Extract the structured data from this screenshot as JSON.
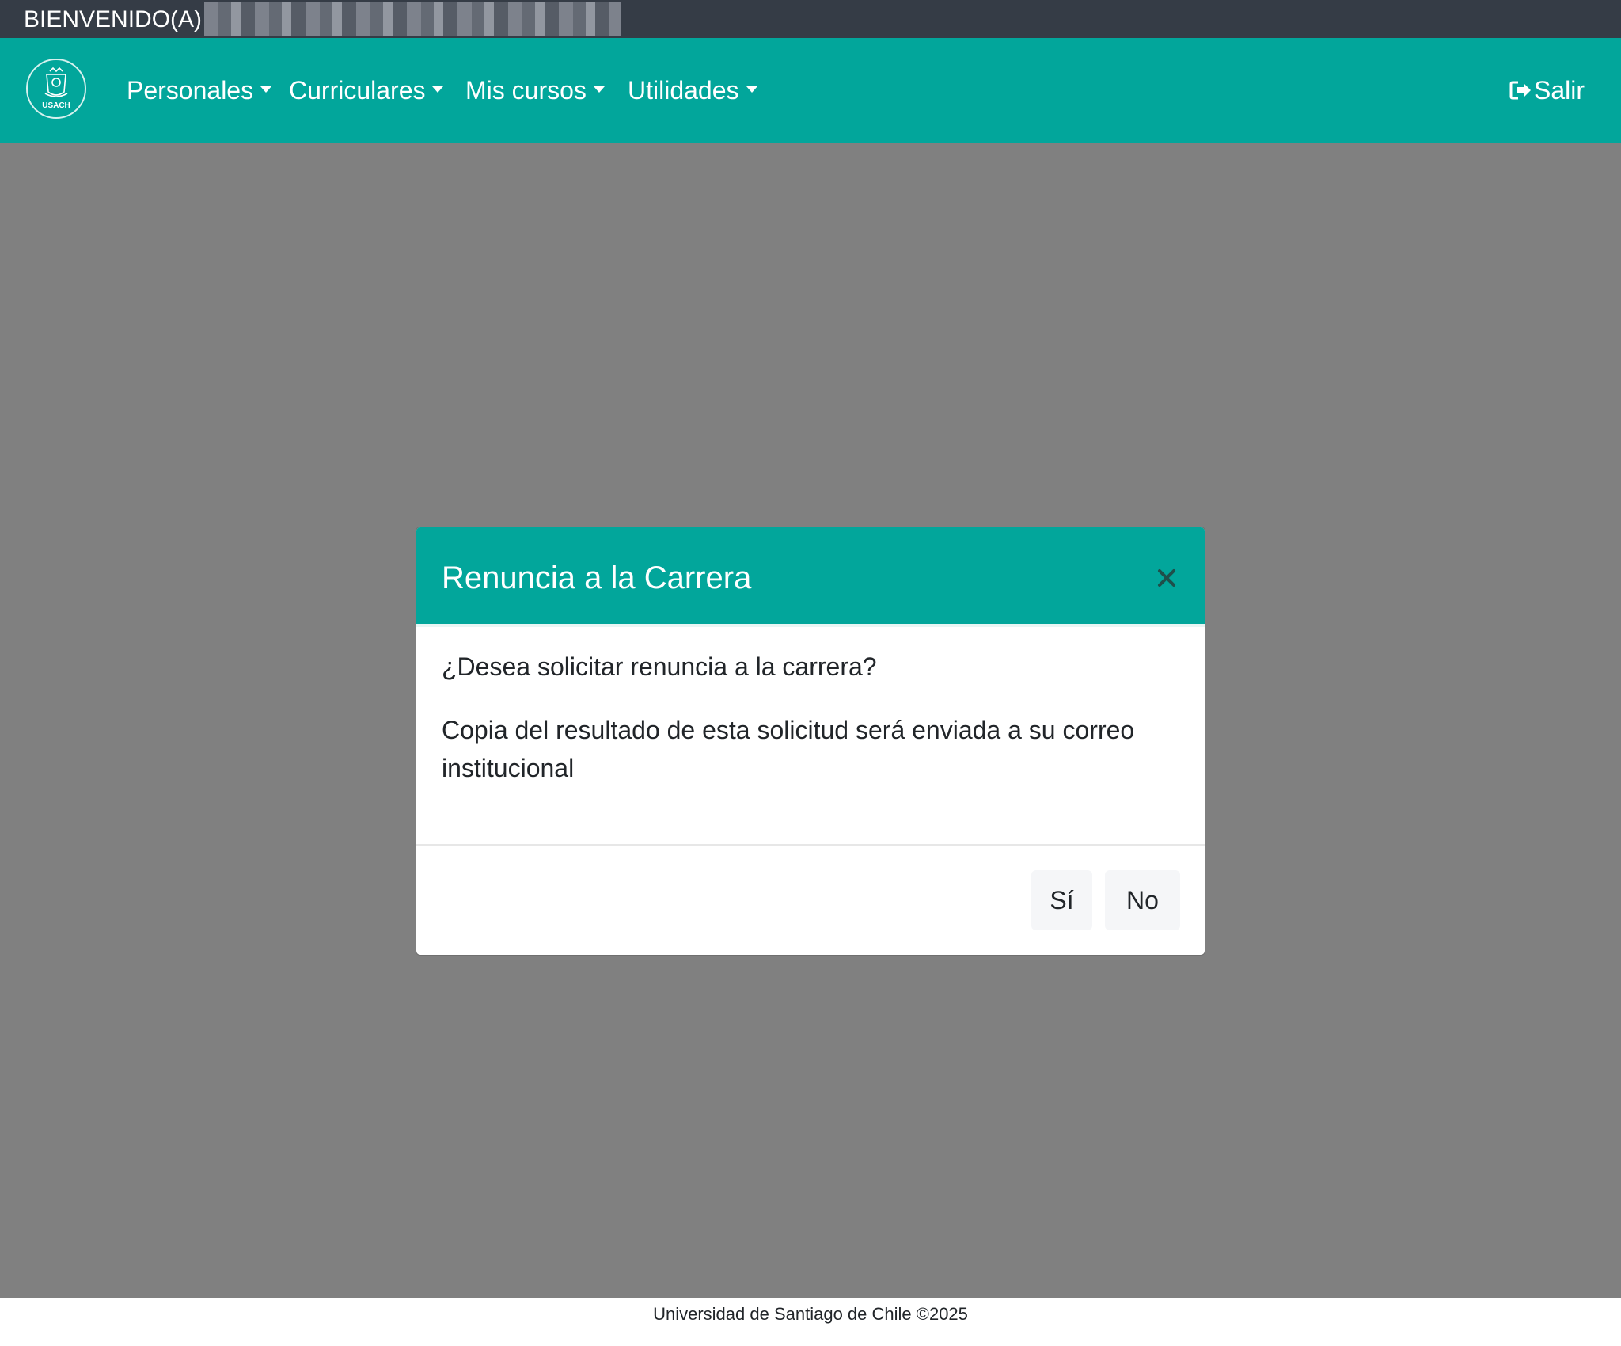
{
  "topbar": {
    "welcome": "BIENVENIDO(A)"
  },
  "navbar": {
    "logo_text": "USACH",
    "menu": [
      {
        "label": "Personales"
      },
      {
        "label": "Curriculares"
      },
      {
        "label": "Mis cursos"
      },
      {
        "label": "Utilidades"
      }
    ],
    "logout_label": "Salir"
  },
  "modal": {
    "title": "Renuncia a la Carrera",
    "question": "¿Desea solicitar renuncia a la carrera?",
    "note": "Copia del resultado de esta solicitud será enviada a su correo institucional",
    "yes_label": "Sí",
    "no_label": "No"
  },
  "footer": {
    "text": "Universidad de Santiago de Chile ©2025"
  },
  "colors": {
    "brand": "#02a69b",
    "topbar": "#353c46",
    "backdrop": "#808080"
  },
  "icons": {
    "logo": "usach-logo-icon",
    "logout": "sign-out-icon",
    "close": "close-icon",
    "dropdown": "caret-down-icon"
  }
}
